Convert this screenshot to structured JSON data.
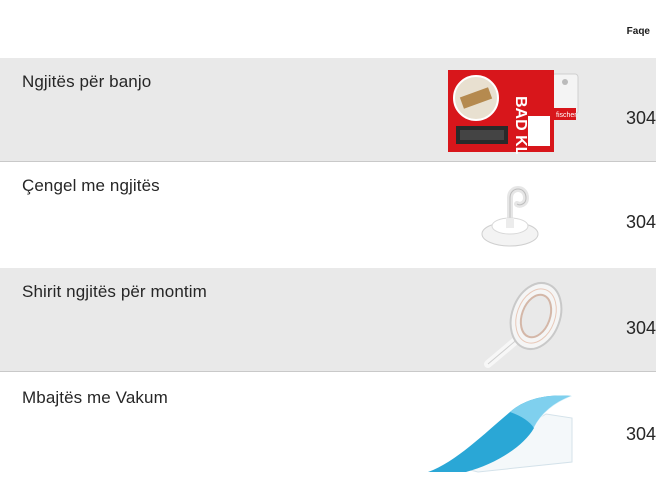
{
  "header": {
    "page_label": "Faqe"
  },
  "entries": [
    {
      "title": "Ngjitës për banjo",
      "page": "304",
      "thumbnail_icon": "bath-adhesive-package-icon",
      "package_text": "BAD KLEBER",
      "brand": "fischer"
    },
    {
      "title": "Çengel me ngjitës",
      "page": "304",
      "thumbnail_icon": "adhesive-hook-icon"
    },
    {
      "title": "Shirit ngjitës për montim",
      "page": "304",
      "thumbnail_icon": "mounting-tape-roll-icon"
    },
    {
      "title": "Mbajtës me Vakum",
      "page": "304",
      "thumbnail_icon": "vacuum-pad-icon"
    }
  ],
  "colors": {
    "shaded_row": "#e9e9e9",
    "package_red": "#d8161b",
    "vacuum_blue": "#2aa7d6"
  }
}
